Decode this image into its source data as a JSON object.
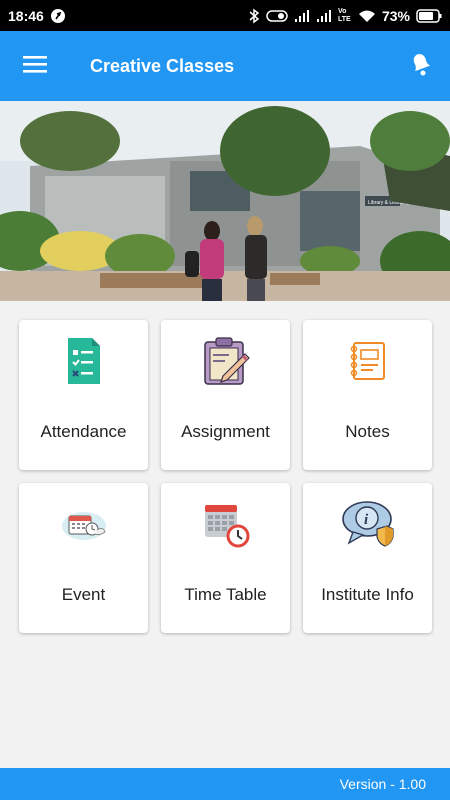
{
  "status_bar": {
    "time": "18:46",
    "network": "Vo LTE",
    "battery": "73%"
  },
  "app_bar": {
    "title": "Creative Classes",
    "menu_icon": "hamburger-menu-icon",
    "bell_icon": "bell-icon"
  },
  "banner": {
    "sign_text": "Library & Learning Hub"
  },
  "tiles": [
    {
      "label": "Attendance",
      "icon": "attendance-checklist-icon"
    },
    {
      "label": "Assignment",
      "icon": "clipboard-pencil-icon"
    },
    {
      "label": "Notes",
      "icon": "notebook-icon"
    },
    {
      "label": "Event",
      "icon": "calendar-event-icon"
    },
    {
      "label": "Time Table",
      "icon": "calendar-clock-icon"
    },
    {
      "label": "Institute Info",
      "icon": "info-shield-icon"
    }
  ],
  "footer": {
    "version": "Version - 1.00"
  },
  "colors": {
    "primary": "#2196f3",
    "status_bar": "#000000"
  }
}
